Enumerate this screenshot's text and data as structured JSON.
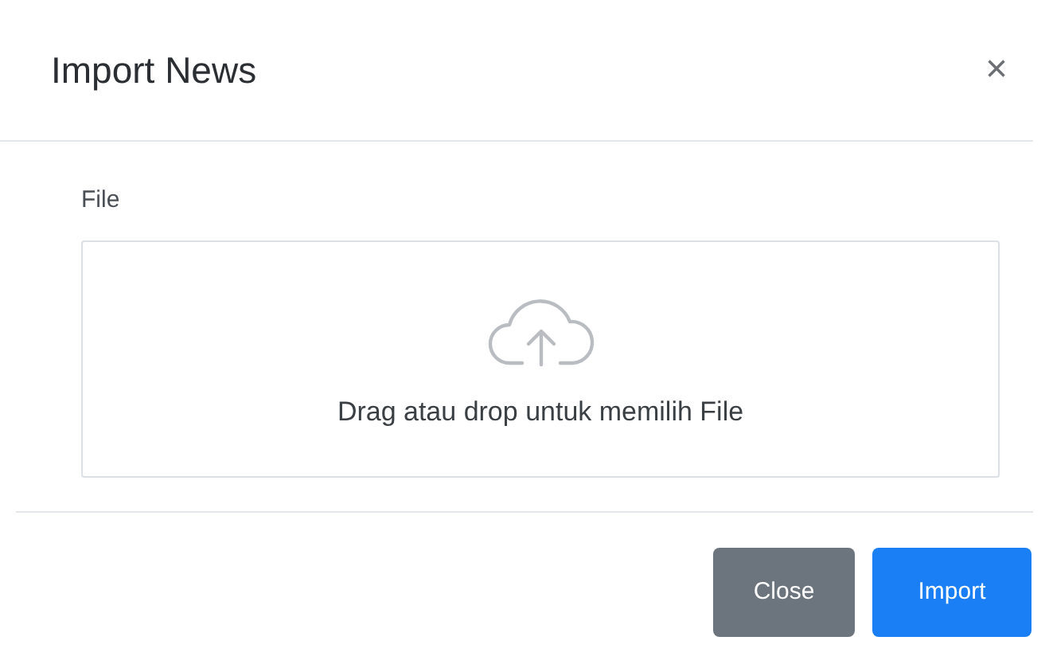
{
  "modal": {
    "title": "Import News",
    "close_glyph": "×"
  },
  "field": {
    "label": "File",
    "dropzone_text": "Drag atau drop untuk memilih File"
  },
  "buttons": [
    {
      "label": "Close",
      "kind": "secondary"
    },
    {
      "label": "Import",
      "kind": "primary"
    }
  ]
}
